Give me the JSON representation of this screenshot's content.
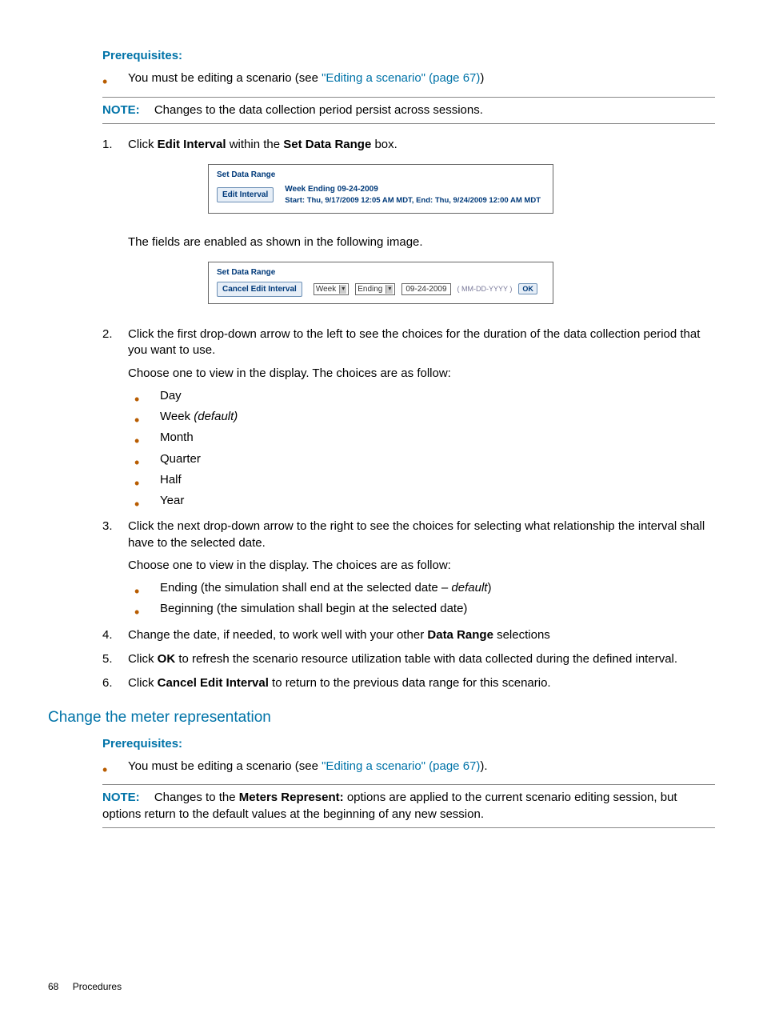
{
  "prereq1": {
    "heading": "Prerequisites:",
    "item_prefix": "You must be editing a scenario (see ",
    "item_link": "\"Editing a scenario\" (page 67)",
    "item_suffix": ")"
  },
  "note1": {
    "label": "NOTE:",
    "text": "Changes to the data collection period persist across sessions."
  },
  "step1": {
    "pre": "Click ",
    "b1": "Edit Interval",
    "mid": " within the ",
    "b2": "Set Data Range",
    "post": " box."
  },
  "fig1": {
    "title": "Set Data Range",
    "btn": "Edit Interval",
    "line1": "Week    Ending  09-24-2009",
    "line2": "Start: Thu, 9/17/2009 12:05 AM MDT, End: Thu, 9/24/2009 12:00 AM MDT"
  },
  "between_text": "The fields are enabled as shown in the following image.",
  "fig2": {
    "title": "Set Data Range",
    "btn": "Cancel Edit Interval",
    "sel1": "Week",
    "sel2": "Ending",
    "input": "09-24-2009",
    "hint": "( MM-DD-YYYY )",
    "ok": "OK"
  },
  "step2": {
    "p1": "Click the first drop-down arrow to the left to see the choices for the duration of the data collection period that you want to use.",
    "p2": "Choose one to view in the display. The choices are as follow:",
    "opts": {
      "o1": "Day",
      "o2a": "Week ",
      "o2b": "(default)",
      "o3": "Month",
      "o4": "Quarter",
      "o5": "Half",
      "o6": "Year"
    }
  },
  "step3": {
    "p1": "Click the next drop-down arrow to the right to see the choices for selecting what relationship the interval shall have to the selected date.",
    "p2": "Choose one to view in the display. The choices are as follow:",
    "o1a": "Ending (the simulation shall end at the selected date – ",
    "o1b": "default",
    "o1c": ")",
    "o2": "Beginning (the simulation shall begin at the selected date)"
  },
  "step4": {
    "pre": "Change the date, if needed, to work well with your other ",
    "b1": "Data Range",
    "post": " selections"
  },
  "step5": {
    "pre": "Click ",
    "b1": "OK",
    "post": " to refresh the scenario resource utilization table with data collected during the defined interval."
  },
  "step6": {
    "pre": "Click ",
    "b1": "Cancel Edit Interval",
    "post": " to return to the previous data range for this scenario."
  },
  "section2": {
    "heading": "Change the meter representation"
  },
  "prereq2": {
    "heading": "Prerequisites:",
    "item_prefix": "You must be editing a scenario (see ",
    "item_link": "\"Editing a scenario\" (page 67)",
    "item_suffix": ")."
  },
  "note2": {
    "label": "NOTE:",
    "pre": "Changes to the ",
    "b1": "Meters Represent:",
    "post": " options are applied to the current scenario editing session, but options return to the default values at the beginning of any new session."
  },
  "footer": {
    "page": "68",
    "title": "Procedures"
  }
}
